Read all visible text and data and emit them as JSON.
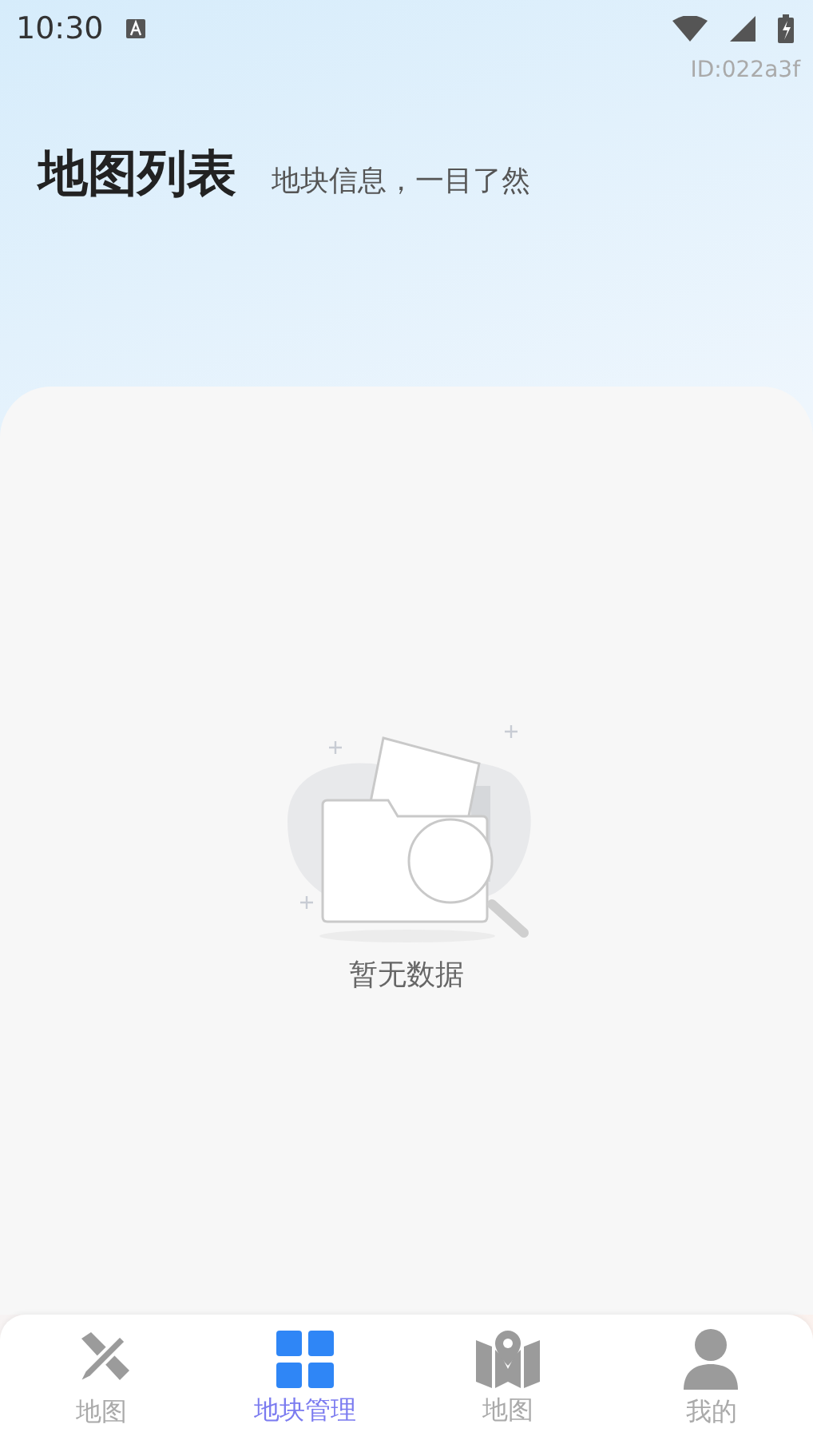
{
  "status_bar": {
    "time": "10:30"
  },
  "device_id": "ID:022a3f",
  "header": {
    "title": "地图列表",
    "subtitle": "地块信息，一目了然"
  },
  "empty_state": {
    "message": "暂无数据"
  },
  "bottom_nav": [
    {
      "label": "地图",
      "kind": "ruler",
      "selected": false
    },
    {
      "label": "地块管理",
      "kind": "grid",
      "selected": true
    },
    {
      "label": "地图",
      "kind": "map",
      "selected": false
    },
    {
      "label": "我的",
      "kind": "person",
      "selected": false
    }
  ]
}
